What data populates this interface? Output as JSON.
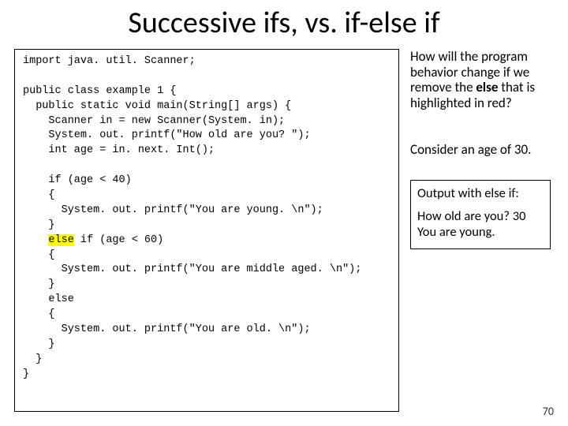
{
  "title": "Successive ifs, vs. if-else if",
  "code": {
    "l1": "import java. util. Scanner;",
    "l2": "",
    "l3": "public class example 1 {",
    "l4": "  public static void main(String[] args) {",
    "l5": "    Scanner in = new Scanner(System. in);",
    "l6": "    System. out. printf(\"How old are you? \");",
    "l7": "    int age = in. next. Int();",
    "l8": "",
    "l9": "    if (age < 40)",
    "l10": "    {",
    "l11": "      System. out. printf(\"You are young. \\n\");",
    "l12": "    }",
    "l13a": "    ",
    "l13_hl": "else",
    "l13b": " if (age < 60)",
    "l14": "    {",
    "l15": "      System. out. printf(\"You are middle aged. \\n\");",
    "l16": "    }",
    "l17": "    else",
    "l18": "    {",
    "l19": "      System. out. printf(\"You are old. \\n\");",
    "l20": "    }",
    "l21": "  }",
    "l22": "}"
  },
  "question": {
    "p1a": "How will the program behavior change if we remove the ",
    "p1b": "else",
    "p1c": " that is highlighted in red?"
  },
  "consider": "Consider an age of 30.",
  "output": {
    "heading": "Output with else if:",
    "line1": "How old are you? 30",
    "line2": "You are young."
  },
  "pagenum": "70"
}
